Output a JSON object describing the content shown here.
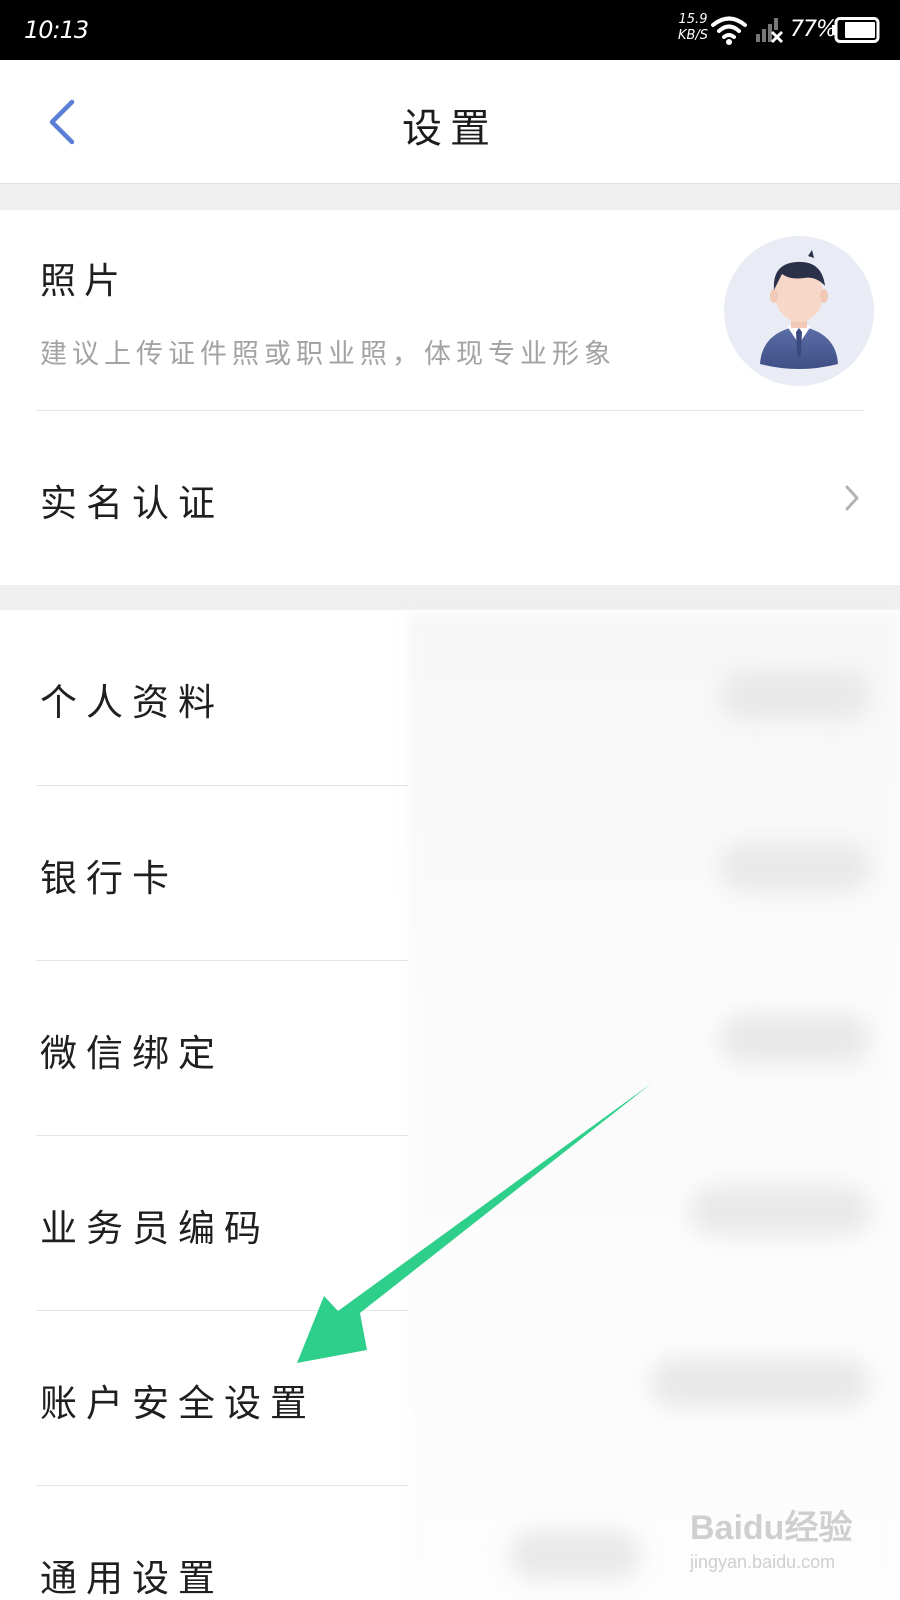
{
  "status_bar": {
    "time": "10:13",
    "net_speed_value": "15.9",
    "net_speed_unit": "KB/S",
    "battery": "77%",
    "icons": [
      "wifi-icon",
      "signal-no-service-icon",
      "battery-icon"
    ]
  },
  "header": {
    "title": "设置",
    "back_icon": "chevron-left-icon",
    "accent_color": "#5b7fd6"
  },
  "profile": {
    "photo_label": "照片",
    "photo_hint": "建议上传证件照或职业照，体现专业形象",
    "avatar_icon": "default-avatar-icon",
    "realname_label": "实名认证",
    "realname_icon": "chevron-right-icon"
  },
  "menu": {
    "items": [
      {
        "label": "个人资料"
      },
      {
        "label": "银行卡"
      },
      {
        "label": "微信绑定"
      },
      {
        "label": "业务员编码"
      },
      {
        "label": "账户安全设置"
      },
      {
        "label": "通用设置"
      }
    ]
  },
  "annotation": {
    "arrow_color": "#2ecf8a",
    "arrow_icon": "green-arrow-pointer"
  },
  "watermark": {
    "logo": "Baidu经验",
    "url": "jingyan.baidu.com"
  }
}
